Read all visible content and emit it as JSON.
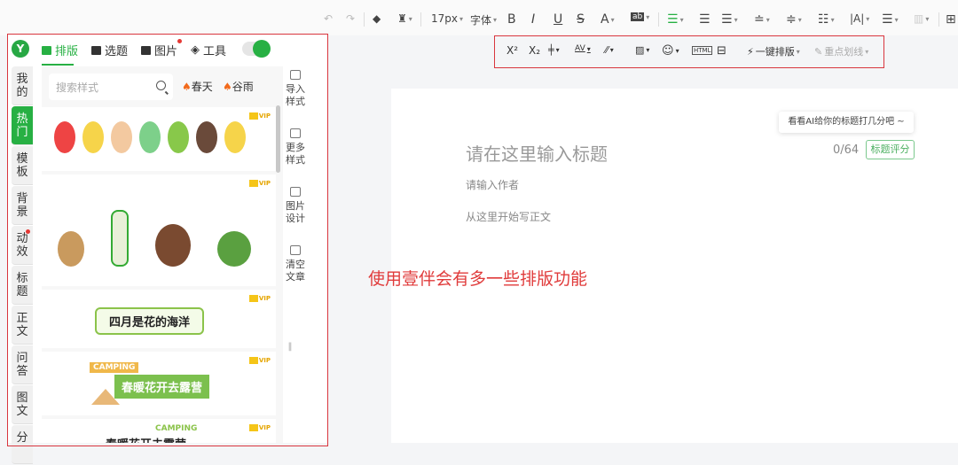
{
  "toolbar": {
    "font_size": "17px",
    "font_family": "字体",
    "bold": "B",
    "italic": "I",
    "underline": "U",
    "strike": "S",
    "color": "A",
    "highlight": "ab"
  },
  "toolbar2": {
    "superscript": "X²",
    "subscript": "X₂",
    "html": "HTML",
    "one_click": "一键排版",
    "key_underline": "重点划线"
  },
  "panel": {
    "logo": "Y",
    "tabs": [
      {
        "label": "排版"
      },
      {
        "label": "选题"
      },
      {
        "label": "图片"
      },
      {
        "label": "工具"
      }
    ],
    "side_tabs": [
      {
        "label": "我的"
      },
      {
        "label": "热门"
      },
      {
        "label": "模板"
      },
      {
        "label": "背景"
      },
      {
        "label": "动效"
      },
      {
        "label": "标题"
      },
      {
        "label": "正文"
      },
      {
        "label": "问答"
      },
      {
        "label": "图文"
      },
      {
        "label": "分"
      }
    ],
    "search_placeholder": "搜索样式",
    "hot_tags": [
      "春天",
      "谷雨"
    ],
    "vip": "VIP",
    "styles": [
      {
        "text": "四月是花的海洋"
      },
      {
        "tag": "CAMPING",
        "text": "春暖花开去露营"
      },
      {
        "tag": "CAMPING",
        "text": "春暖花开去露营"
      }
    ],
    "right_buttons": [
      "导入样式",
      "更多样式",
      "图片设计",
      "清空文章"
    ]
  },
  "editor": {
    "ai_tip": "看看AI给你的标题打几分吧 ~",
    "title_placeholder": "请在这里输入标题",
    "count": "0/64",
    "score_button": "标题评分",
    "author_placeholder": "请输入作者",
    "body_placeholder": "从这里开始写正文"
  },
  "annotation": "使用壹伴会有多一些排版功能",
  "colors": {
    "accent": "#27b043",
    "annotation": "#e03b3b"
  }
}
